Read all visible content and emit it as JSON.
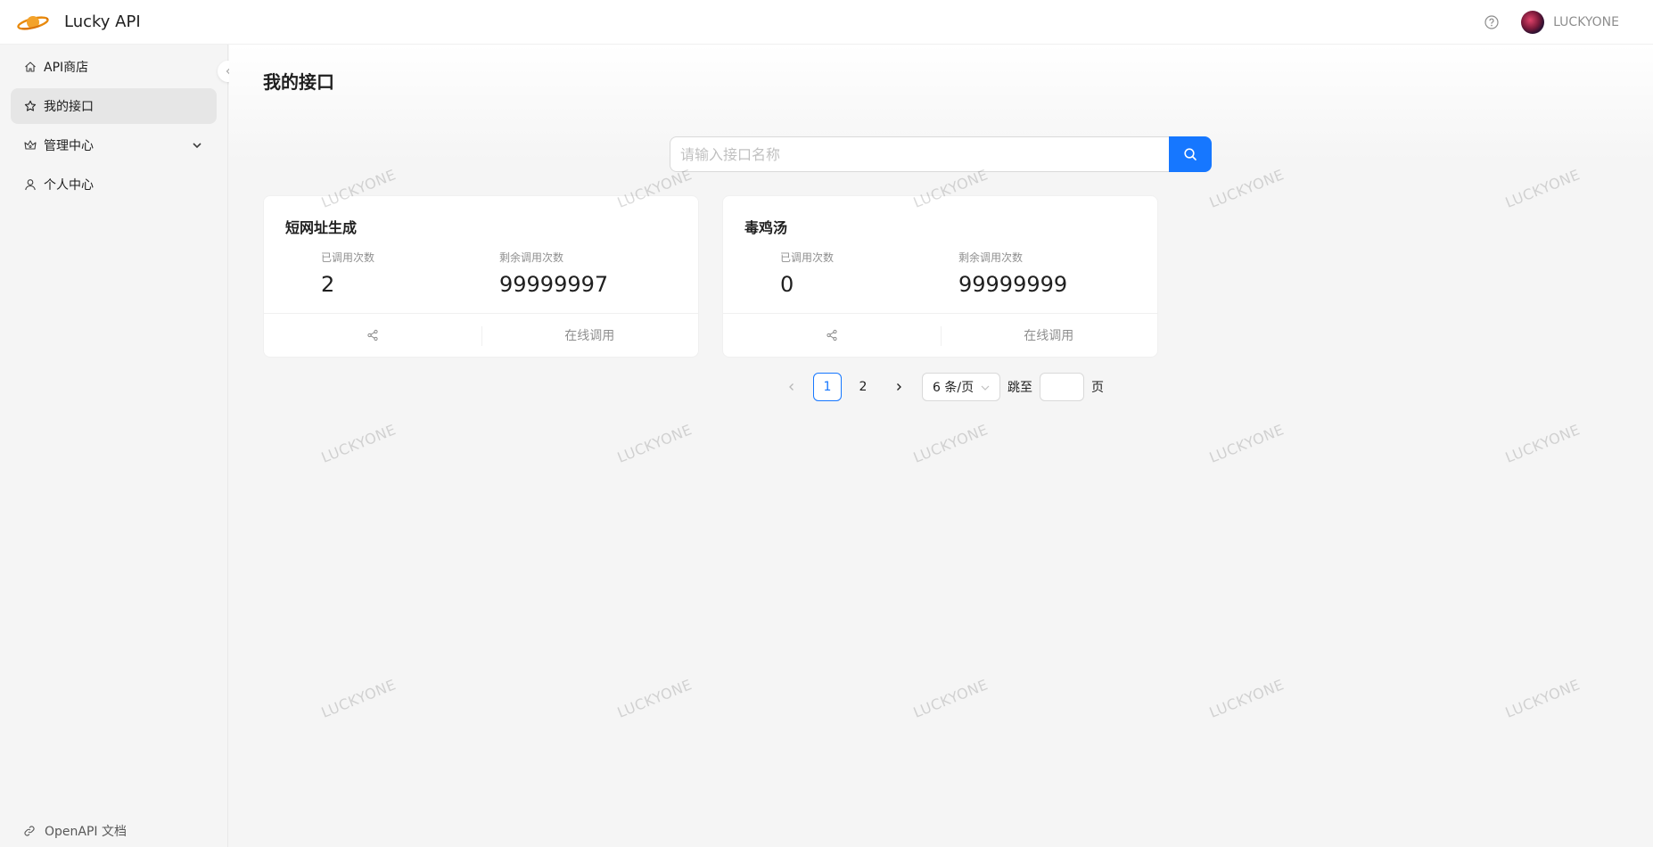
{
  "header": {
    "app_title": "Lucky API",
    "user_name": "LUCKYONE"
  },
  "sidebar": {
    "items": [
      {
        "label": "API商店",
        "icon": "home-icon"
      },
      {
        "label": "我的接口",
        "icon": "star-icon",
        "selected": true
      },
      {
        "label": "管理中心",
        "icon": "crown-icon",
        "expandable": true
      },
      {
        "label": "个人中心",
        "icon": "user-icon"
      }
    ],
    "footer_link": "OpenAPI 文档"
  },
  "main": {
    "page_title": "我的接口",
    "search": {
      "placeholder": "请输入接口名称"
    },
    "cards": [
      {
        "title": "短网址生成",
        "used_label": "已调用次数",
        "used_value": "2",
        "remaining_label": "剩余调用次数",
        "remaining_value": "99999997",
        "action_label": "在线调用"
      },
      {
        "title": "毒鸡汤",
        "used_label": "已调用次数",
        "used_value": "0",
        "remaining_label": "剩余调用次数",
        "remaining_value": "99999999",
        "action_label": "在线调用"
      }
    ],
    "pagination": {
      "pages": [
        "1",
        "2"
      ],
      "current": "1",
      "page_size": "6 条/页",
      "jump_label": "跳至",
      "page_suffix": "页"
    }
  },
  "watermark": "LUCKYONE",
  "colors": {
    "primary": "#1677ff"
  }
}
